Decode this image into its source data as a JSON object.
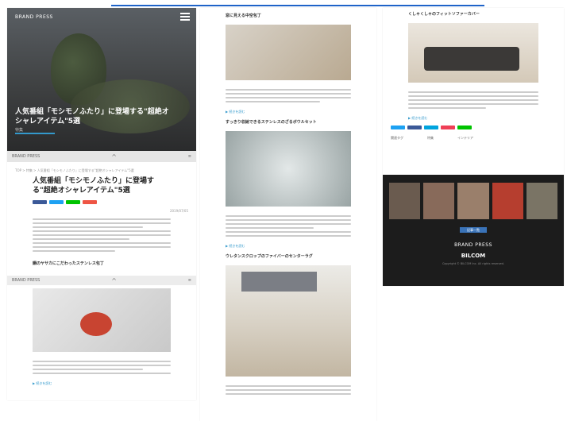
{
  "brand": "BRAND PRESS",
  "hero": {
    "title": "人気番組「モシモノふたり」に登場する\"超絶オシャレアイテム\"5選",
    "category": "特集"
  },
  "article": {
    "breadcrumb": "TOP > 特集 > 人気番組「モシモノふたり」に登場する\"超絶オシャレアイテム\"5選",
    "title": "人気番組「モシモノふたり」に登場する\"超絶オシャレアイテム\"5選",
    "date": "2019/07/05"
  },
  "sections": [
    {
      "heading": "鋼のヤサカにこだわったステンレス包丁"
    },
    {
      "heading": "窓に見える中空包丁"
    },
    {
      "heading": "すっきり収納できるステンレスのざるボウルセット"
    },
    {
      "heading": "ウレタンスクロップのファイバーのセンターラグ"
    }
  ],
  "right": {
    "heading": "くしゃくしゃのフィットソファーカバー",
    "share": [
      "Twitter",
      "Facebook",
      "B!",
      "Pocket",
      "LINE"
    ],
    "tag_label": "関連タグ",
    "tags": [
      "特集",
      "インテリア"
    ],
    "footer_button": "記事一覧",
    "footer_logo": "BRAND PRESS",
    "footer_logo2": "BILCOM",
    "copyright": "Copyright © BILCOM Inc. All rights reserved."
  },
  "more_label": "▶ 続きを読む"
}
